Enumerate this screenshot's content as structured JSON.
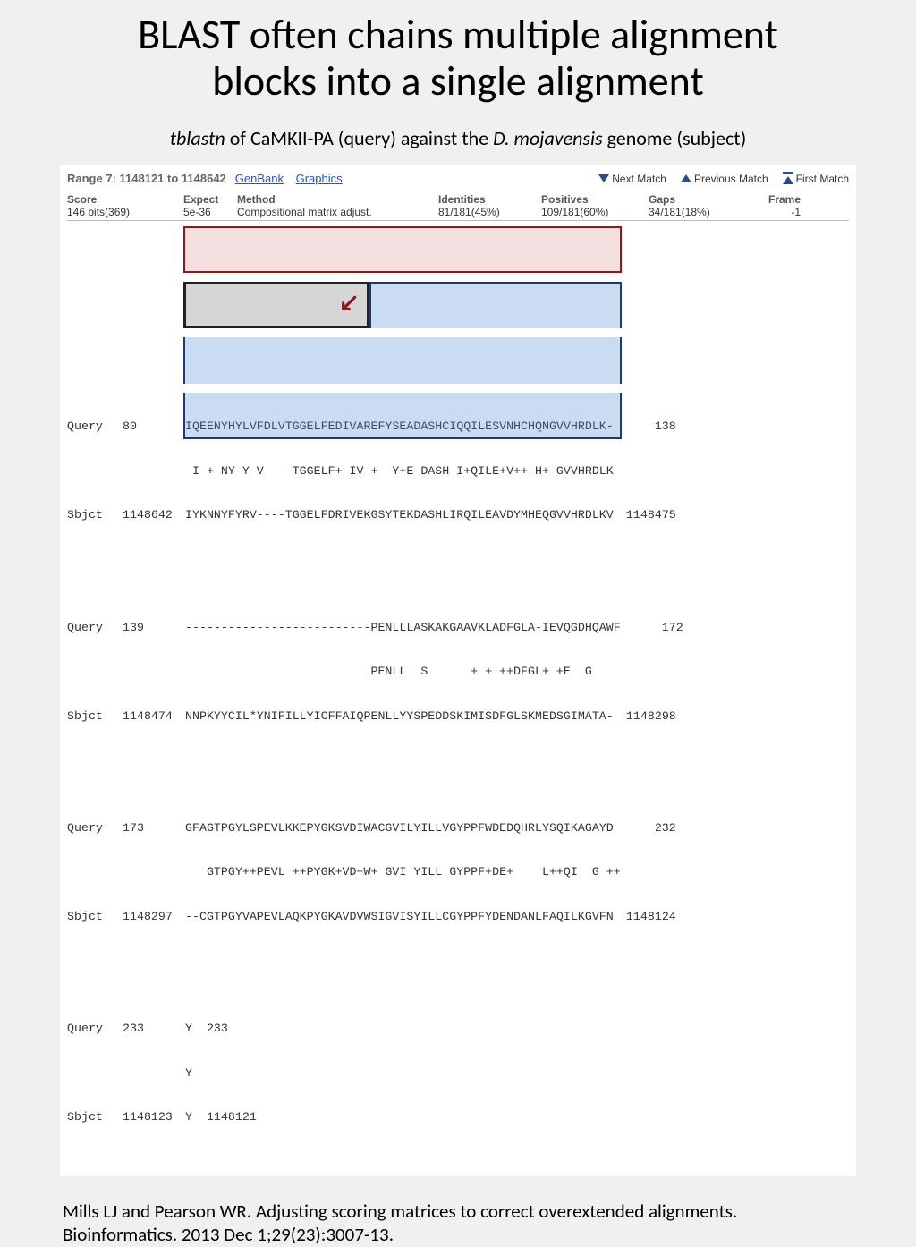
{
  "title_line1": "BLAST often chains multiple alignment",
  "title_line2": "blocks into a single alignment",
  "subtitle": {
    "italic1": "tblastn",
    "mid1": " of CaMKII-PA (query) against the ",
    "italic2": "D. mojavensis",
    "mid2": " genome (subject)"
  },
  "blast": {
    "range_label": "Range 7: 1148121 to 1148642",
    "link_genbank": "GenBank",
    "link_graphics": "Graphics",
    "nav_next": "Next Match",
    "nav_prev": "Previous Match",
    "nav_first": "First Match",
    "headers": {
      "score": "Score",
      "expect": "Expect",
      "method": "Method",
      "identities": "Identities",
      "positives": "Positives",
      "gaps": "Gaps",
      "frame": "Frame"
    },
    "values": {
      "score": "146 bits(369)",
      "expect": "5e-36",
      "method": "Compositional matrix adjust.",
      "identities": "81/181(45%)",
      "positives": "109/181(60%)",
      "gaps": "34/181(18%)",
      "frame": "-1"
    },
    "block1": {
      "q_label": "Query",
      "q_start": "80",
      "q_seq": "IQEENYHYLVFDLVTGGELFEDIVAREFYSEADASHCIQQILESVNHCHQNGVVHRDLK-",
      "q_end": "138",
      "m_seq": " I + NY Y V    TGGELF+ IV +  Y+E DASH I+QILE+V++ H+ GVVHRDLK ",
      "s_label": "Sbjct",
      "s_start": "1148642",
      "s_seq": "IYKNNYFYRV----TGGELFDRIVEKGSYTEKDASHLIRQILEAVDYMHEQGVVHRDLKV",
      "s_end": "1148475"
    },
    "block2": {
      "q_label": "Query",
      "q_start": "139",
      "q_seq": "--------------------------PENLLLASKAKGAAVKLADFGLA-IEVQGDHQAWF",
      "q_end": "172",
      "m_seq": "                          PENLL  S      + + ++DFGL+ +E  G     ",
      "s_label": "Sbjct",
      "s_start": "1148474",
      "s_seq": "NNPKYYCIL*YNIFILLYICFFAIQPENLLYYSPEDDSKIMISDFGLSKMEDSGIMATA-",
      "s_end": "1148298"
    },
    "block3": {
      "q_label": "Query",
      "q_start": "173",
      "q_seq": "GFAGTPGYLSPEVLKKEPYGKSVDIWACGVILYILLVGYPPFWDEDQHRLYSQIKAGAYD",
      "q_end": "232",
      "m_seq": "   GTPGY++PEVL ++PYGK+VD+W+ GVI YILL GYPPF+DE+    L++QI  G ++",
      "s_label": "Sbjct",
      "s_start": "1148297",
      "s_seq": "--CGTPGYVAPEVLAQKPYGKAVDVWSIGVISYILLCGYPPFYDENDANLFAQILKGVFN",
      "s_end": "1148124"
    },
    "block4": {
      "q_label": "Query",
      "q_start": "233",
      "q_seq": "Y  233",
      "m_seq": "Y",
      "s_label": "Sbjct",
      "s_start": "1148123",
      "s_seq": "Y  1148121"
    }
  },
  "citation": "Mills LJ and Pearson WR. Adjusting scoring matrices to correct overextended alignments. Bioinformatics. 2013 Dec 1;29(23):3007-13."
}
